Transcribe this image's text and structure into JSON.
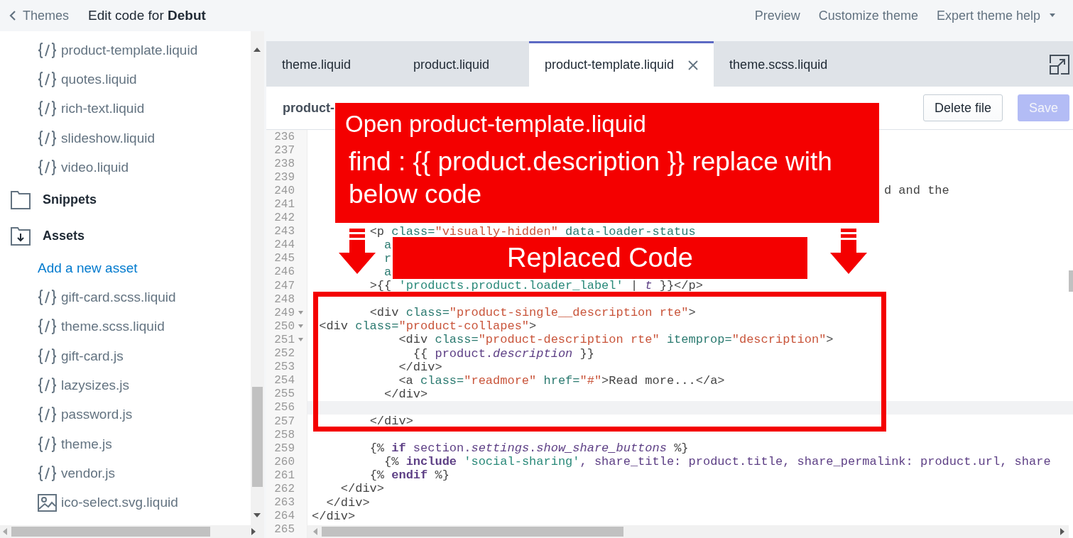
{
  "top_bar": {
    "back_label": "Themes",
    "title": "Edit code for **Debut**",
    "nav": [
      {
        "label": "Preview",
        "dropdown": false
      },
      {
        "label": "Customize theme",
        "dropdown": false
      },
      {
        "label": "Expert theme help",
        "dropdown": true
      }
    ]
  },
  "sidebar": {
    "items": [
      {
        "kind": "file",
        "label": "product-template.liquid"
      },
      {
        "kind": "file",
        "label": "quotes.liquid"
      },
      {
        "kind": "file",
        "label": "rich-text.liquid"
      },
      {
        "kind": "file",
        "label": "slideshow.liquid"
      },
      {
        "kind": "file",
        "label": "video.liquid"
      },
      {
        "kind": "folder",
        "label": "Snippets"
      },
      {
        "kind": "download-folder",
        "label": "Assets"
      },
      {
        "kind": "link",
        "label": "Add a new asset"
      },
      {
        "kind": "file",
        "label": "gift-card.scss.liquid"
      },
      {
        "kind": "file",
        "label": "theme.scss.liquid"
      },
      {
        "kind": "file",
        "label": "gift-card.js"
      },
      {
        "kind": "file",
        "label": "lazysizes.js"
      },
      {
        "kind": "file",
        "label": "password.js"
      },
      {
        "kind": "file",
        "label": "theme.js"
      },
      {
        "kind": "file",
        "label": "vendor.js"
      },
      {
        "kind": "image",
        "label": "ico-select.svg.liquid"
      }
    ]
  },
  "editor": {
    "tabs": [
      {
        "label": "theme.liquid",
        "selected": false
      },
      {
        "label": "product.liquid",
        "selected": false
      },
      {
        "label": "product-template.liquid",
        "selected": true
      },
      {
        "label": "theme.scss.liquid",
        "selected": false
      }
    ],
    "file_name": "product-",
    "buttons": [
      {
        "label": "Delete file",
        "disabled": false
      },
      {
        "label": "Save",
        "disabled": true
      }
    ],
    "lines": [
      {
        "number": "236",
        "active": false,
        "foldable": false
      },
      {
        "number": "237",
        "active": false,
        "foldable": false
      },
      {
        "number": "238",
        "active": false,
        "foldable": false
      },
      {
        "number": "239",
        "active": false,
        "foldable": false
      },
      {
        "number": "240",
        "active": false,
        "foldable": false,
        "tokens": [
          {
            "text": "                                                                               d and the",
            "kind": "plain"
          }
        ]
      },
      {
        "number": "241",
        "active": false,
        "foldable": false
      },
      {
        "number": "242",
        "active": false,
        "foldable": false
      },
      {
        "number": "243",
        "active": false,
        "foldable": false,
        "tokens": [
          {
            "text": "        <p",
            "kind": "tag"
          },
          {
            "text": " class=",
            "kind": "attr"
          },
          {
            "text": "\"visually-hidden\"",
            "kind": "string"
          },
          {
            "text": " data-loader-status",
            "kind": "attr"
          }
        ]
      },
      {
        "number": "244",
        "active": false,
        "foldable": false,
        "tokens": [
          {
            "text": "          a",
            "kind": "attr"
          }
        ]
      },
      {
        "number": "245",
        "active": false,
        "foldable": false,
        "tokens": [
          {
            "text": "          r",
            "kind": "attr"
          }
        ]
      },
      {
        "number": "246",
        "active": false,
        "foldable": false,
        "tokens": [
          {
            "text": "          a",
            "kind": "attr"
          }
        ]
      },
      {
        "number": "247",
        "active": false,
        "foldable": false,
        "tokens": [
          {
            "text": "        >{{ ",
            "kind": "plain"
          },
          {
            "text": "'products.product.loader_label'",
            "kind": "quoted"
          },
          {
            "text": " | ",
            "kind": "plain"
          },
          {
            "text": "t",
            "kind": "italic"
          },
          {
            "text": " }}</p>",
            "kind": "plain"
          }
        ]
      },
      {
        "number": "248",
        "active": false,
        "foldable": false
      },
      {
        "number": "249",
        "active": false,
        "foldable": true,
        "tokens": [
          {
            "text": "        <div",
            "kind": "tag"
          },
          {
            "text": " class=",
            "kind": "attr"
          },
          {
            "text": "\"product-single__description rte\"",
            "kind": "string"
          },
          {
            "text": ">",
            "kind": "tag"
          }
        ]
      },
      {
        "number": "250",
        "active": false,
        "foldable": true,
        "tokens": [
          {
            "text": " <div",
            "kind": "tag"
          },
          {
            "text": " class=",
            "kind": "attr"
          },
          {
            "text": "\"product-collapes\"",
            "kind": "string"
          },
          {
            "text": ">",
            "kind": "tag"
          }
        ]
      },
      {
        "number": "251",
        "active": false,
        "foldable": true,
        "tokens": [
          {
            "text": "            <div",
            "kind": "tag"
          },
          {
            "text": " class=",
            "kind": "attr"
          },
          {
            "text": "\"product-description rte\"",
            "kind": "string"
          },
          {
            "text": " itemprop=",
            "kind": "attr"
          },
          {
            "text": "\"description\"",
            "kind": "string"
          },
          {
            "text": ">",
            "kind": "tag"
          }
        ]
      },
      {
        "number": "252",
        "active": false,
        "foldable": false,
        "tokens": [
          {
            "text": "              {{ ",
            "kind": "plain"
          },
          {
            "text": "product.",
            "kind": "var"
          },
          {
            "text": "description",
            "kind": "italic"
          },
          {
            "text": " }}",
            "kind": "plain"
          }
        ]
      },
      {
        "number": "253",
        "active": false,
        "foldable": false,
        "tokens": [
          {
            "text": "            </div>",
            "kind": "tag"
          }
        ]
      },
      {
        "number": "254",
        "active": false,
        "foldable": false,
        "tokens": [
          {
            "text": "            <a",
            "kind": "tag"
          },
          {
            "text": " class=",
            "kind": "attr"
          },
          {
            "text": "\"readmore\"",
            "kind": "string"
          },
          {
            "text": " href=",
            "kind": "attr"
          },
          {
            "text": "\"#\"",
            "kind": "string"
          },
          {
            "text": ">Read more...</a>",
            "kind": "tag"
          }
        ]
      },
      {
        "number": "255",
        "active": false,
        "foldable": false,
        "tokens": [
          {
            "text": "          </div>",
            "kind": "tag"
          }
        ]
      },
      {
        "number": "256",
        "active": true,
        "foldable": false
      },
      {
        "number": "257",
        "active": false,
        "foldable": false,
        "tokens": [
          {
            "text": "        </div>",
            "kind": "tag"
          }
        ]
      },
      {
        "number": "258",
        "active": false,
        "foldable": false
      },
      {
        "number": "259",
        "active": false,
        "foldable": false,
        "tokens": [
          {
            "text": "        {% ",
            "kind": "plain"
          },
          {
            "text": "if",
            "kind": "keyword"
          },
          {
            "text": " section.",
            "kind": "var"
          },
          {
            "text": "settings",
            "kind": "italic"
          },
          {
            "text": ".",
            "kind": "var"
          },
          {
            "text": "show_share_buttons",
            "kind": "italic"
          },
          {
            "text": " %}",
            "kind": "plain"
          }
        ]
      },
      {
        "number": "260",
        "active": false,
        "foldable": false,
        "tokens": [
          {
            "text": "          {% ",
            "kind": "plain"
          },
          {
            "text": "include",
            "kind": "keyword"
          },
          {
            "text": " 'social-sharing'",
            "kind": "quoted"
          },
          {
            "text": ", share_title: product.title, share_permalink: product.url, share",
            "kind": "var"
          }
        ]
      },
      {
        "number": "261",
        "active": false,
        "foldable": false,
        "tokens": [
          {
            "text": "        {% ",
            "kind": "plain"
          },
          {
            "text": "endif",
            "kind": "keyword"
          },
          {
            "text": " %}",
            "kind": "plain"
          }
        ]
      },
      {
        "number": "262",
        "active": false,
        "foldable": false,
        "tokens": [
          {
            "text": "    </div>",
            "kind": "tag"
          }
        ]
      },
      {
        "number": "263",
        "active": false,
        "foldable": false,
        "tokens": [
          {
            "text": "  </div>",
            "kind": "tag"
          }
        ]
      },
      {
        "number": "264",
        "active": false,
        "foldable": false,
        "tokens": [
          {
            "text": "</div>",
            "kind": "tag"
          }
        ]
      },
      {
        "number": "265",
        "active": false,
        "foldable": false
      }
    ]
  },
  "annotations": {
    "note_title": "Open product-template.liquid",
    "note_body": "find : {{ product.description }} replace with below code",
    "label": "Replaced Code"
  }
}
